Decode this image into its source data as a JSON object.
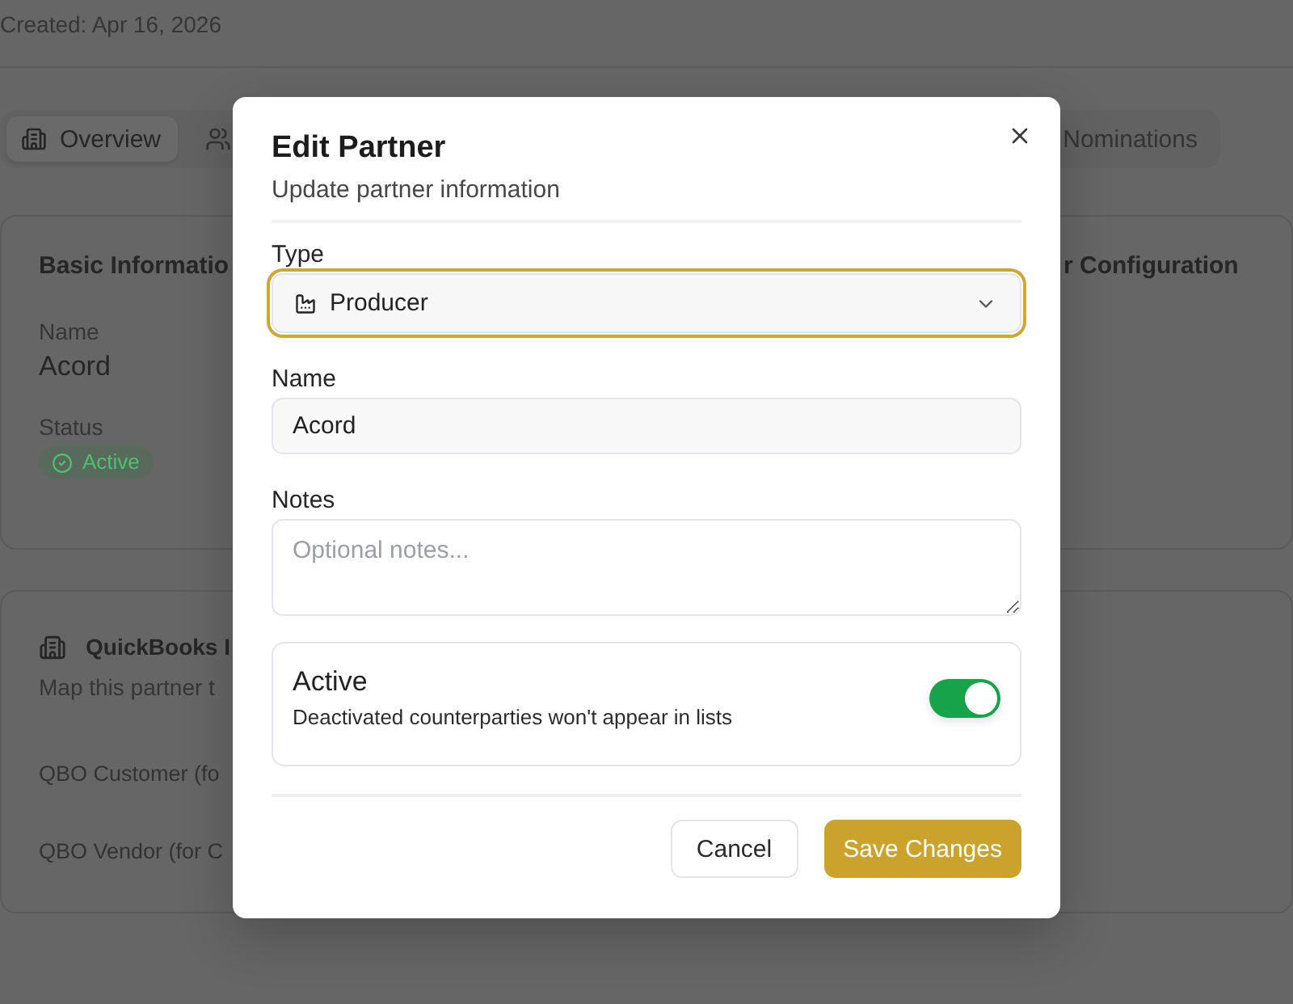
{
  "page": {
    "created": "Created: Apr 16, 2026",
    "tabs": [
      {
        "label": "Overview",
        "selected": true
      },
      {
        "selected": false
      },
      {
        "label": "Nominations",
        "selected": false
      }
    ],
    "basic_info": {
      "title": "Basic Informatio",
      "fields": [
        {
          "label": "Name",
          "kind": "text",
          "value": "Acord"
        },
        {
          "label": "Status",
          "kind": "badge",
          "value": "Active"
        }
      ]
    },
    "config_card": {
      "title": "r Configuration"
    },
    "quickbooks": {
      "title": "QuickBooks I",
      "subtitle": "Map this partner t",
      "rows": [
        "QBO Customer (fo",
        "QBO Vendor (for C"
      ]
    }
  },
  "dialog": {
    "title": "Edit Partner",
    "subtitle": "Update partner information",
    "type": {
      "label": "Type",
      "value": "Producer",
      "focused": true
    },
    "name": {
      "label": "Name",
      "value": "Acord"
    },
    "notes": {
      "label": "Notes",
      "placeholder": "Optional notes..."
    },
    "active": {
      "label": "Active",
      "description": "Deactivated counterparties won't appear in lists",
      "on": true
    },
    "buttons": [
      {
        "label": "Cancel",
        "kind": "secondary"
      },
      {
        "label": "Save Changes",
        "kind": "primary"
      }
    ]
  }
}
